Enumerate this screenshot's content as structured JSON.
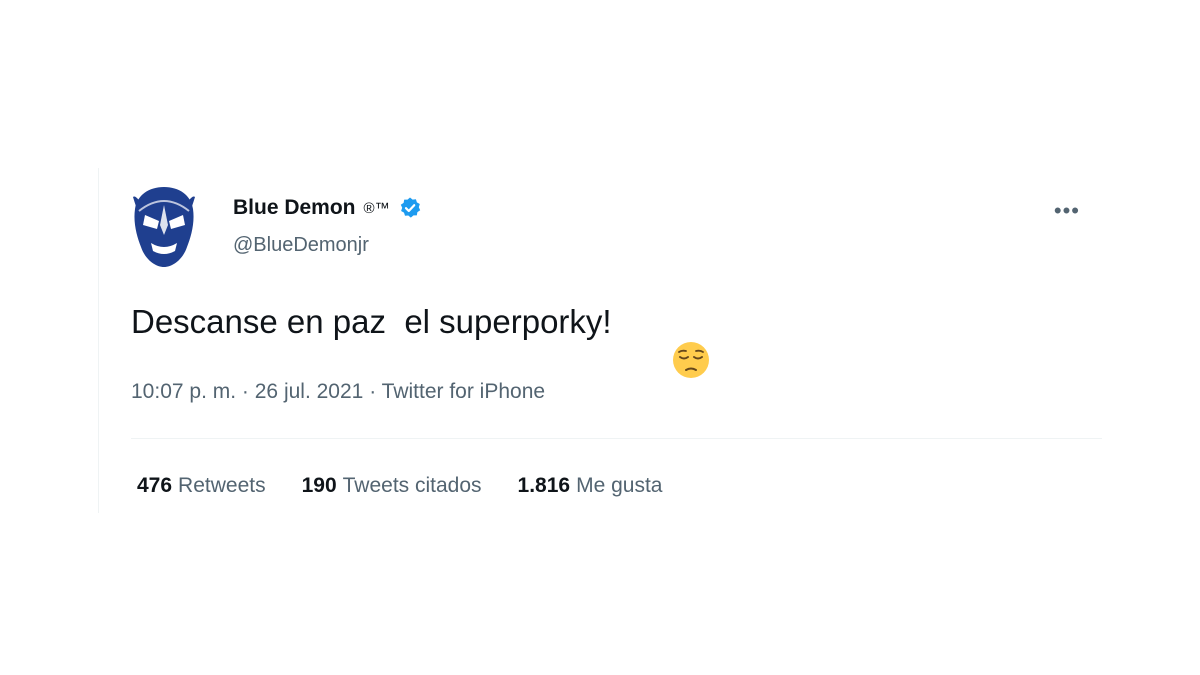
{
  "user": {
    "display_name": "Blue Demon",
    "badge_text": "®™",
    "handle": "@BlueDemonjr"
  },
  "tweet": {
    "text": "Descanse en paz  el superporky!",
    "emoji": "pensive-face",
    "time": "10:07 p. m.",
    "separator": "·",
    "date": "26 jul. 2021",
    "source": "Twitter for iPhone"
  },
  "stats": [
    {
      "count": "476",
      "label": "Retweets"
    },
    {
      "count": "190",
      "label": "Tweets citados"
    },
    {
      "count": "1.816",
      "label": "Me gusta"
    }
  ],
  "colors": {
    "text_primary": "#0f1419",
    "text_secondary": "#536471",
    "verified_blue": "#1d9bf0",
    "avatar_blue": "#1f3f8f"
  },
  "icons": {
    "more": "more-horizontal-icon",
    "verified": "verified-badge-icon"
  }
}
